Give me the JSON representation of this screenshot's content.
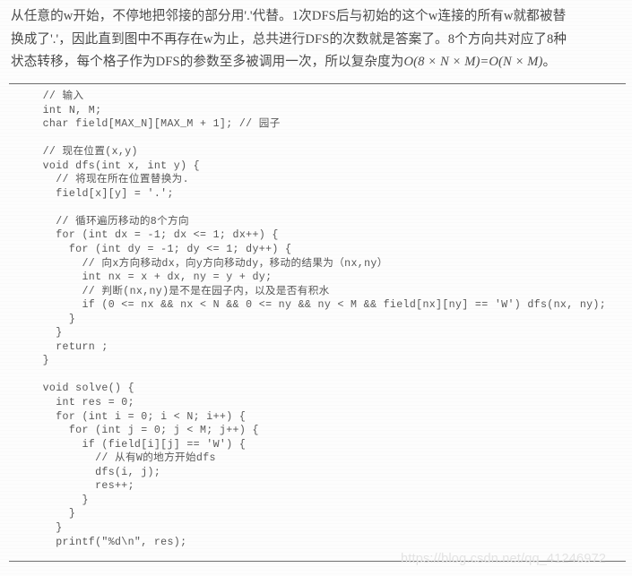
{
  "document": {
    "intro_paragraph": {
      "lines": [
        "从任意的w开始，不停地把邻接的部分用'.'代替。1次DFS后与初始的这个w连接的所有w就都被替",
        "换成了'.'，因此直到图中不再存在w为止，总共进行DFS的次数就是答案了。8个方向共对应了8种",
        "状态转移，每个格子作为DFS的参数至多被调用一次，所以复杂度为"
      ],
      "complexity_formula": "O(8 × N × M)=O(N × M)",
      "trailing_punctuation": "。"
    },
    "code_block": {
      "language": "c",
      "lines": [
        "  // 输入",
        "  int N, M;",
        "  char field[MAX_N][MAX_M + 1]; // 园子",
        "",
        "  // 现在位置(x,y)",
        "  void dfs(int x, int y) {",
        "    // 将现在所在位置替换为.",
        "    field[x][y] = '.';",
        "",
        "    // 循环遍历移动的8个方向",
        "    for (int dx = -1; dx <= 1; dx++) {",
        "      for (int dy = -1; dy <= 1; dy++) {",
        "        // 向x方向移动dx，向y方向移动dy，移动的结果为（nx,ny）",
        "        int nx = x + dx, ny = y + dy;",
        "        // 判断(nx,ny)是不是在园子内，以及是否有积水",
        "        if (0 <= nx && nx < N && 0 <= ny && ny < M && field[nx][ny] == 'W') dfs(nx, ny);",
        "      }",
        "    }",
        "    return ;",
        "  }",
        "",
        "  void solve() {",
        "    int res = 0;",
        "    for (int i = 0; i < N; i++) {",
        "      for (int j = 0; j < M; j++) {",
        "        if (field[i][j] == 'W') {",
        "          // 从有W的地方开始dfs",
        "          dfs(i, j);",
        "          res++;",
        "        }",
        "      }",
        "    }",
        "    printf(\"%d\\n\", res);",
        "  }"
      ]
    },
    "watermark": {
      "text": "https://blog.csdn.net/qq_41246972"
    },
    "colors": {
      "page_background": "#fdfdfd",
      "body_text": "#4a4a4a",
      "code_text": "#575757",
      "rule_line": "#6d6d6d",
      "watermark_text": "#e3e3e3"
    }
  }
}
